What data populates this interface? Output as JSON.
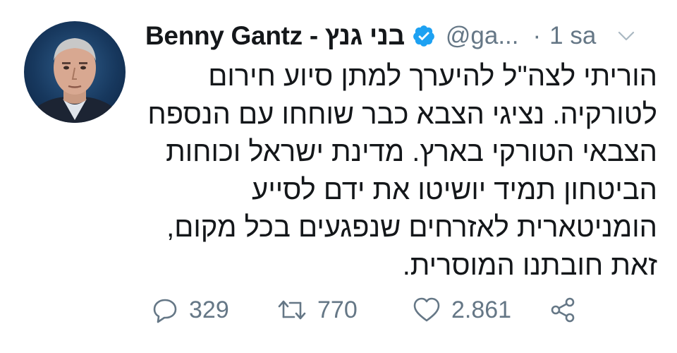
{
  "tweet": {
    "display_name": "Benny Gantz - בני גנץ",
    "handle": "@ga...",
    "separator": "·",
    "time": "1 sa",
    "body_lines": [
      "הוריתי לצה\"ל להיערך למתן סיוע חירום",
      "לטורקיה. נציגי הצבא כבר שוחחו עם הנספח",
      "הצבאי הטורקי בארץ. מדינת ישראל וכוחות",
      "הביטחון תמיד יושיטו את ידם לסייע",
      "הומניטארית לאזרחים שנפגעים בכל מקום,",
      "זאת חובתנו המוסרית."
    ],
    "stats": {
      "replies": "329",
      "retweets": "770",
      "likes": "2.861"
    }
  },
  "icons": {
    "avatar": "avatar-photo",
    "verified": "verified-badge-icon",
    "caret": "chevron-down-icon",
    "reply": "reply-icon",
    "retweet": "retweet-icon",
    "like": "heart-icon",
    "share": "share-icon"
  },
  "colors": {
    "text": "#14171a",
    "muted": "#657786",
    "verified": "#1da1f2",
    "background": "#ffffff"
  }
}
